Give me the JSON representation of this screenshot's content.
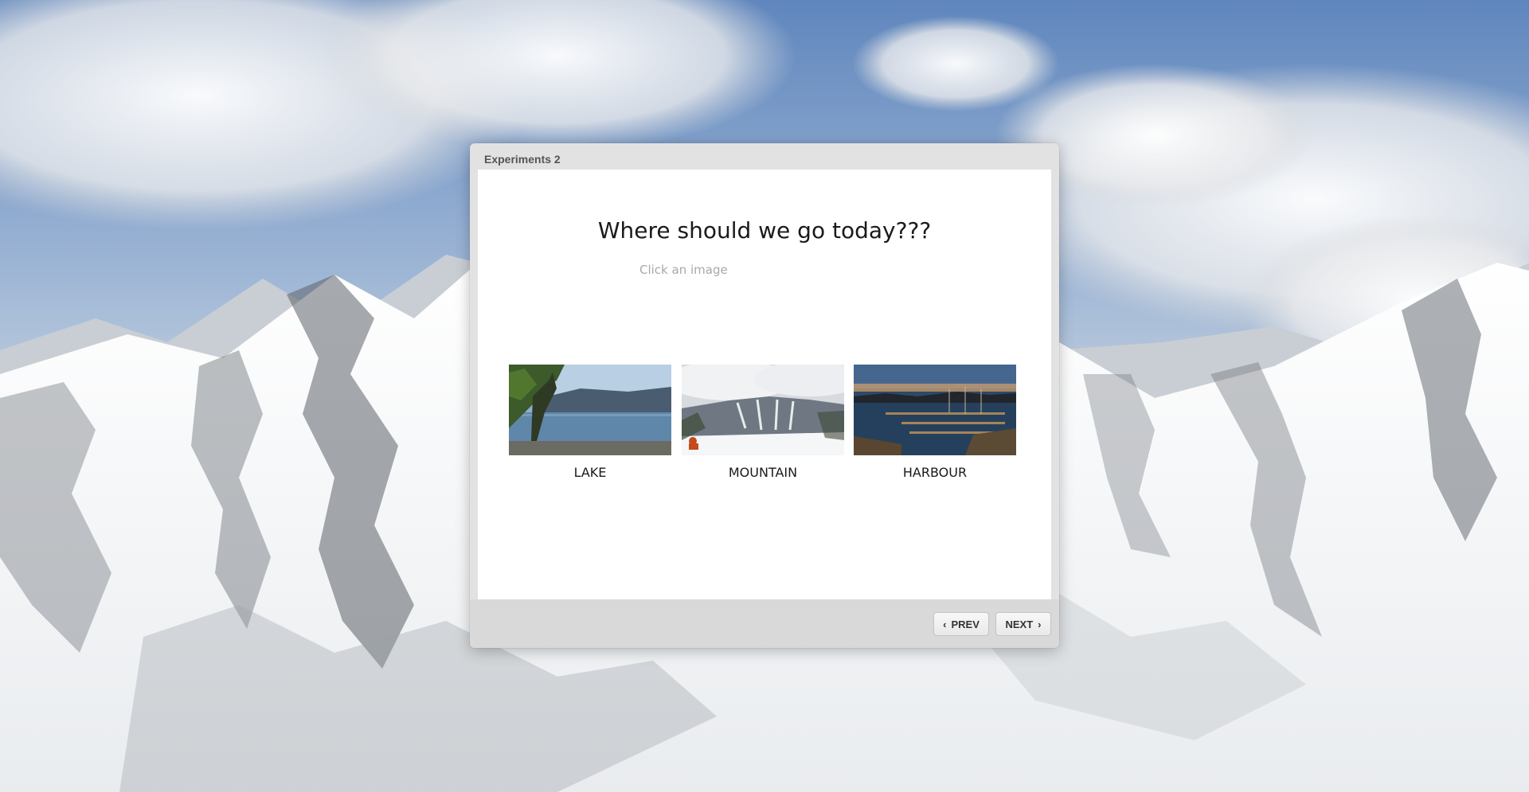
{
  "dialog": {
    "title": "Experiments 2",
    "question": "Where should we go today???",
    "hint": "Click an image"
  },
  "choices": [
    {
      "label": "LAKE",
      "image": "lake-photo"
    },
    {
      "label": "MOUNTAIN",
      "image": "ski-mountain-photo"
    },
    {
      "label": "HARBOUR",
      "image": "harbour-photo"
    }
  ],
  "footer": {
    "prev_label": "PREV",
    "next_label": "NEXT",
    "prev_icon": "chevron-left-icon",
    "next_icon": "chevron-right-icon"
  },
  "colors": {
    "dialog_frame": "#e2e2e2",
    "dialog_body": "#ffffff",
    "footer": "#d9d9d9",
    "hint_text": "#a9a9a9"
  }
}
